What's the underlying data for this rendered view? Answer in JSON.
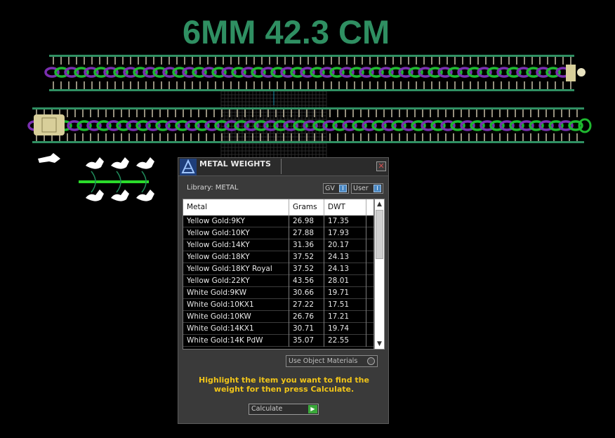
{
  "viewport": {
    "title": "6MM 42.3 CM",
    "chain_color_primary": "#7a2fb0",
    "chain_color_secondary": "#1fb830",
    "rail_color": "#2f8f62",
    "clasp_color": "#d8cf9a",
    "grid_color": "#2a2a2a"
  },
  "dialog": {
    "title": "METAL WEIGHTS",
    "close_glyph": "✕",
    "library_label": "Library: METAL",
    "toggle_gv": "GV",
    "toggle_user": "User",
    "toggle_knob": "I",
    "columns": [
      "Metal",
      "Grams",
      "DWT"
    ],
    "rows": [
      [
        "Yellow Gold:9KY",
        "26.98",
        "17.35"
      ],
      [
        "Yellow Gold:10KY",
        "27.88",
        "17.93"
      ],
      [
        "Yellow Gold:14KY",
        "31.36",
        "20.17"
      ],
      [
        "Yellow Gold:18KY",
        "37.52",
        "24.13"
      ],
      [
        "Yellow Gold:18KY Royal",
        "37.52",
        "24.13"
      ],
      [
        "Yellow Gold:22KY",
        "43.56",
        "28.01"
      ],
      [
        "White Gold:9KW",
        "30.66",
        "19.71"
      ],
      [
        "White Gold:10KX1",
        "27.22",
        "17.51"
      ],
      [
        "White Gold:10KW",
        "26.76",
        "17.21"
      ],
      [
        "White Gold:14KX1",
        "30.71",
        "19.74"
      ],
      [
        "White Gold:14K PdW",
        "35.07",
        "22.55"
      ]
    ],
    "scroll_up": "▲",
    "scroll_down": "▼",
    "use_object_materials": "Use Object Materials",
    "instructions": "Highlight the item you want to find the weight for then press Calculate.",
    "calculate_label": "Calculate",
    "calculate_glyph": "▶",
    "accent_color": "#f0c419"
  }
}
